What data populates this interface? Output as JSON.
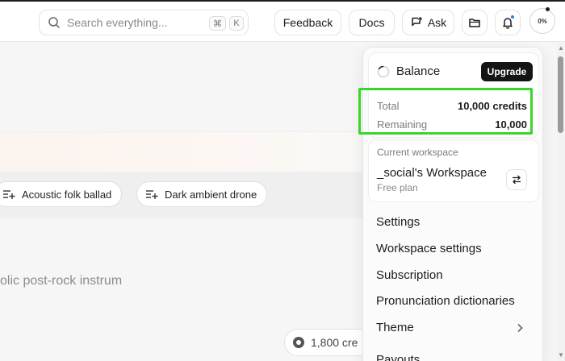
{
  "topbar": {
    "search": {
      "placeholder": "Search everything...",
      "shortcut_mod": "⌘",
      "shortcut_key": "K"
    },
    "feedback_label": "Feedback",
    "docs_label": "Docs",
    "ask_label": "Ask",
    "avatar_text": "0%"
  },
  "main": {
    "chips": [
      {
        "label": "Acoustic folk ballad"
      },
      {
        "label": "Dark ambient drone"
      }
    ],
    "prompt_partial": "olic post-rock instrum",
    "credits_pill": "1,800 cre"
  },
  "dropdown": {
    "balance": {
      "title": "Balance",
      "upgrade_label": "Upgrade",
      "total_label": "Total",
      "total_value": "10,000 credits",
      "remaining_label": "Remaining",
      "remaining_value": "10,000"
    },
    "workspace": {
      "label": "Current workspace",
      "name": "_social's Workspace",
      "plan": "Free plan"
    },
    "menu": [
      {
        "label": "Settings"
      },
      {
        "label": "Workspace settings"
      },
      {
        "label": "Subscription"
      },
      {
        "label": "Pronunciation dictionaries"
      },
      {
        "label": "Theme"
      },
      {
        "label": "Payouts"
      }
    ]
  },
  "colors": {
    "highlight": "#39d62a",
    "notification": "#2f7cf6",
    "upgrade_bg": "#141414"
  }
}
